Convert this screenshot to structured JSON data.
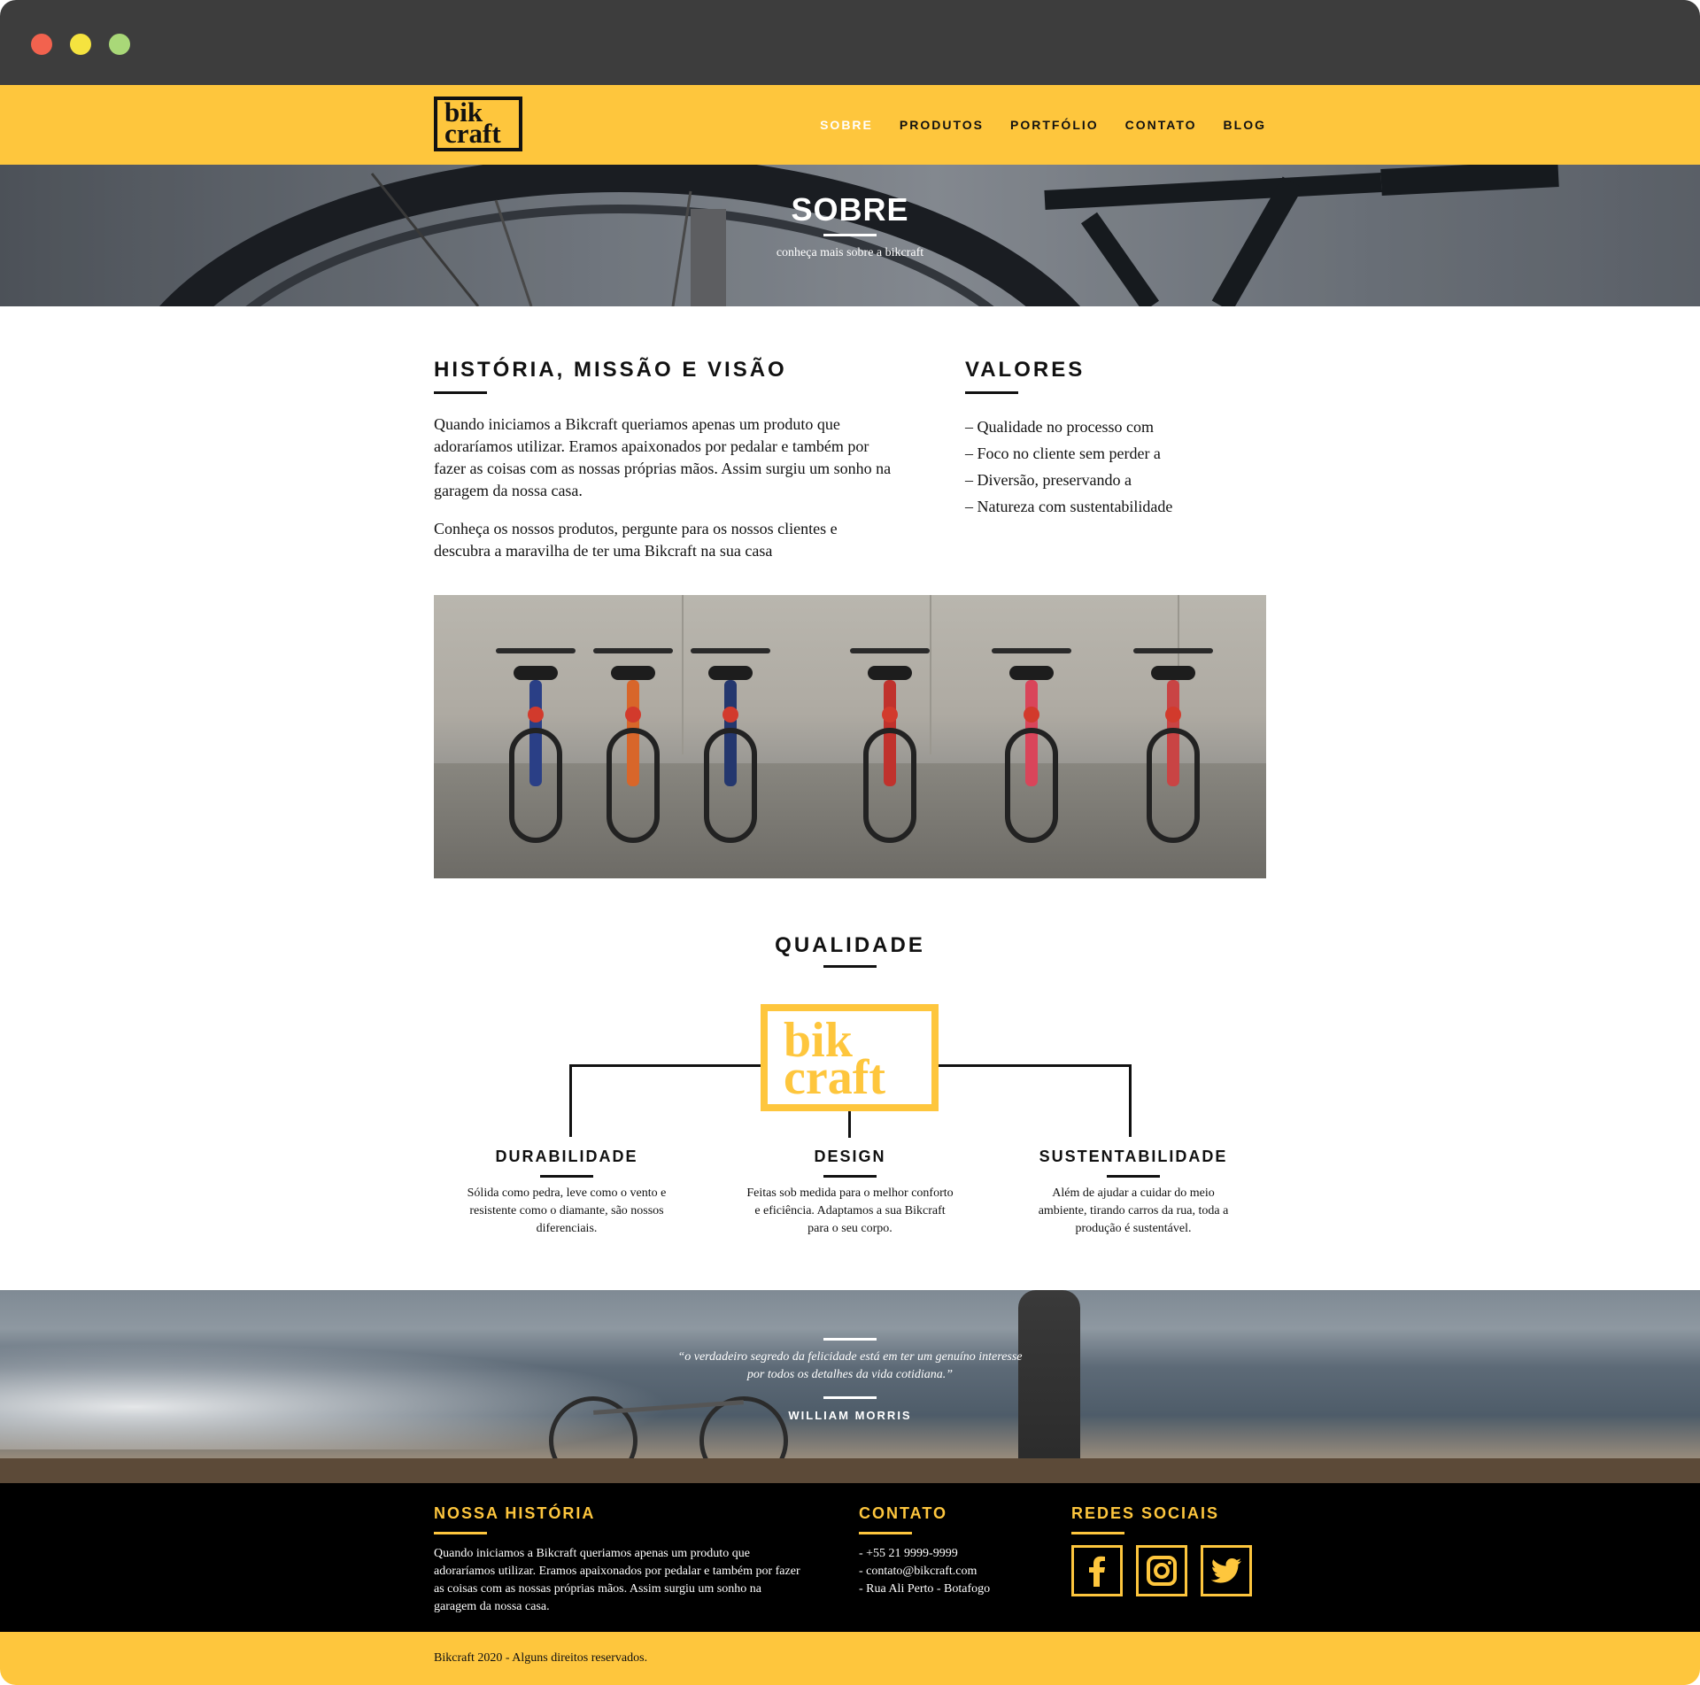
{
  "header": {
    "logo": {
      "line1": "bik",
      "line2": "craft"
    },
    "nav": [
      {
        "label": "SOBRE"
      },
      {
        "label": "PRODUTOS"
      },
      {
        "label": "PORTFÓLIO"
      },
      {
        "label": "CONTATO"
      },
      {
        "label": "BLOG"
      }
    ],
    "active_nav": "SOBRE"
  },
  "hero": {
    "title": "SOBRE",
    "subtitle": "conheça mais sobre a bikcraft"
  },
  "historia": {
    "title": "HISTÓRIA, MISSÃO E VISÃO",
    "p1": "Quando iniciamos a Bikcraft queriamos apenas um produto que adoraríamos utilizar. Eramos apaixonados por pedalar e também por fazer as coisas com as nossas próprias mãos. Assim surgiu um sonho na garagem da nossa casa.",
    "p2": "Conheça os nossos produtos, pergunte para os nossos clientes e descubra a maravilha de ter uma Bikcraft na sua casa"
  },
  "valores": {
    "title": "VALORES",
    "items": [
      "– Qualidade no processo com",
      "– Foco no cliente sem perder a",
      "– Diversão, preservando a",
      "– Natureza com sustentabilidade"
    ]
  },
  "qualidade": {
    "title": "QUALIDADE",
    "logo": {
      "line1": "bik",
      "line2": "craft"
    },
    "features": [
      {
        "title": "DURABILIDADE",
        "text": "Sólida como pedra, leve como o vento e resistente como o diamante, são nossos diferenciais."
      },
      {
        "title": "DESIGN",
        "text": "Feitas sob medida para o melhor conforto e eficiência. Adaptamos a sua Bikcraft para o seu corpo."
      },
      {
        "title": "SUSTENTABILIDADE",
        "text": "Além de ajudar a cuidar do meio ambiente, tirando carros da rua, toda a produção é sustentável."
      }
    ]
  },
  "quote": {
    "text": "“o verdadeiro segredo da felicidade está em ter um genuíno interesse por todos os detalhes da vida cotidiana.”",
    "author": "WILLIAM MORRIS"
  },
  "footer": {
    "historia_title": "NOSSA HISTÓRIA",
    "historia_text": "Quando iniciamos a Bikcraft queriamos apenas um produto que adoraríamos utilizar. Eramos apaixonados por pedalar e também por fazer as coisas com as nossas próprias mãos. Assim surgiu um sonho na garagem da nossa casa.",
    "contato_title": "CONTATO",
    "contato_items": [
      "- +55 21 9999-9999",
      "- contato@bikcraft.com",
      "- Rua Ali Perto - Botafogo"
    ],
    "social_title": "REDES SOCIAIS",
    "social_icons": [
      "facebook-icon",
      "instagram-icon",
      "twitter-icon"
    ]
  },
  "copyright": "Bikcraft 2020 - Alguns direitos reservados.",
  "colors": {
    "accent": "#fec63d",
    "titlebar": "#3d3d3d",
    "footer_bg": "#000000",
    "text": "#111111",
    "traffic_red": "#f2624e",
    "traffic_yellow": "#f5e33f",
    "traffic_green": "#a9d878"
  }
}
